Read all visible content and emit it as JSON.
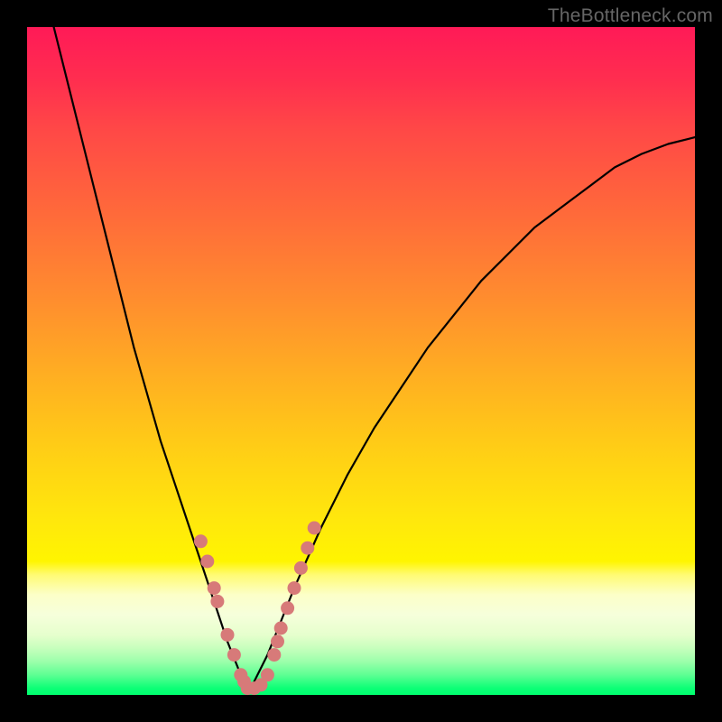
{
  "watermark": "TheBottleneck.com",
  "colors": {
    "frame": "#000000",
    "curve": "#000000",
    "marker_fill": "#d77a79",
    "marker_stroke": "#b85a57"
  },
  "chart_data": {
    "type": "line",
    "title": "",
    "xlabel": "",
    "ylabel": "",
    "xlim": [
      0,
      100
    ],
    "ylim": [
      0,
      100
    ],
    "notes": "V-shaped bottleneck curve with minimum near x≈33; y-axis visually represents percentage bottleneck (high=red top, low=green bottom). No numeric axis ticks or labels are shown.",
    "series": [
      {
        "name": "curve",
        "x": [
          4,
          6,
          8,
          10,
          12,
          14,
          16,
          18,
          20,
          22,
          24,
          26,
          28,
          30,
          32,
          33,
          34,
          36,
          38,
          40,
          44,
          48,
          52,
          56,
          60,
          64,
          68,
          72,
          76,
          80,
          84,
          88,
          92,
          96,
          100
        ],
        "y": [
          100,
          92,
          84,
          76,
          68,
          60,
          52,
          45,
          38,
          32,
          26,
          20,
          14,
          8,
          3,
          0.5,
          2,
          6,
          11,
          16,
          25,
          33,
          40,
          46,
          52,
          57,
          62,
          66,
          70,
          73,
          76,
          79,
          81,
          82.5,
          83.5
        ]
      }
    ],
    "markers": {
      "name": "highlight-dots",
      "x": [
        26,
        27,
        28,
        28.5,
        30,
        31,
        32,
        32.5,
        33,
        34,
        35,
        36,
        37,
        37.5,
        38,
        39,
        40,
        41,
        42,
        43
      ],
      "y": [
        23,
        20,
        16,
        14,
        9,
        6,
        3,
        2,
        1,
        1,
        1.5,
        3,
        6,
        8,
        10,
        13,
        16,
        19,
        22,
        25
      ]
    }
  }
}
